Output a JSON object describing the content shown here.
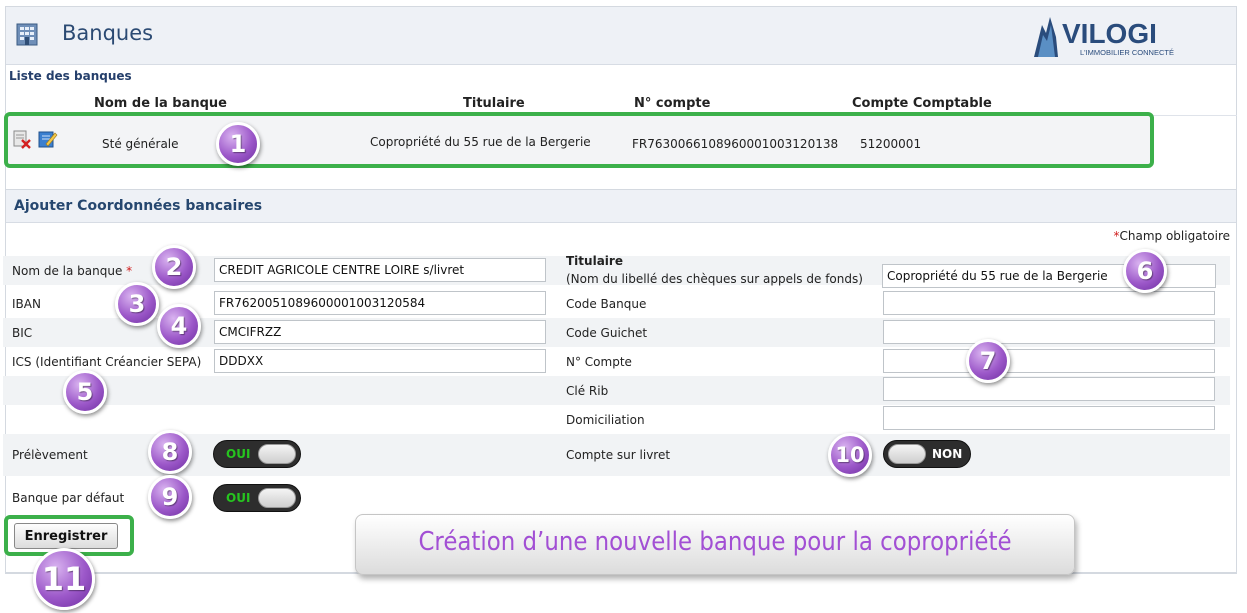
{
  "header": {
    "title": "Banques",
    "logo_text": "VILOGI",
    "logo_tagline": "L'IMMOBILIER CONNECTÉ"
  },
  "list": {
    "title": "Liste des banques",
    "columns": [
      "Nom de la banque",
      "Titulaire",
      "N° compte",
      "Compte Comptable"
    ],
    "rows": [
      {
        "name": "Sté générale",
        "holder": "Copropriété du 55 rue de la Bergerie",
        "account": "FR7630066108960001003120138",
        "ledger": "51200001"
      }
    ]
  },
  "form": {
    "title": "Ajouter Coordonnées bancaires",
    "required_note": "Champ obligatoire",
    "required_mark": "*",
    "left": {
      "bank_name_label": "Nom de la banque",
      "bank_name_value": "CREDIT AGRICOLE CENTRE LOIRE s/livret",
      "iban_label": "IBAN",
      "iban_value": "FR7620051089600001003120584",
      "bic_label": "BIC",
      "bic_value": "CMCIFRZZ",
      "ics_label": "ICS (Identifiant Créancier SEPA)",
      "ics_value": "DDDXX",
      "direct_debit_label": "Prélèvement",
      "default_bank_label": "Banque par défaut"
    },
    "right": {
      "holder_label": "Titulaire",
      "holder_sub": "(Nom du libellé des chèques sur appels de fonds)",
      "holder_value": "Copropriété du 55 rue de la Bergerie",
      "bank_code_label": "Code Banque",
      "branch_code_label": "Code Guichet",
      "account_label": "N° Compte",
      "rib_key_label": "Clé Rib",
      "domiciliation_label": "Domiciliation",
      "savings_label": "Compte sur livret"
    },
    "toggles": {
      "direct_debit": "OUI",
      "default_bank": "OUI",
      "savings": "NON"
    },
    "save_label": "Enregistrer"
  },
  "callout": "Création d’une nouvelle banque pour la copropriété",
  "badges": [
    "1",
    "2",
    "3",
    "4",
    "5",
    "6",
    "7",
    "8",
    "9",
    "10",
    "11"
  ],
  "colors": {
    "accent_green": "#3cb04a",
    "badge_purple": "#9c58c9",
    "header_blue": "#2b4a73",
    "callout_text": "#a24fd4"
  }
}
